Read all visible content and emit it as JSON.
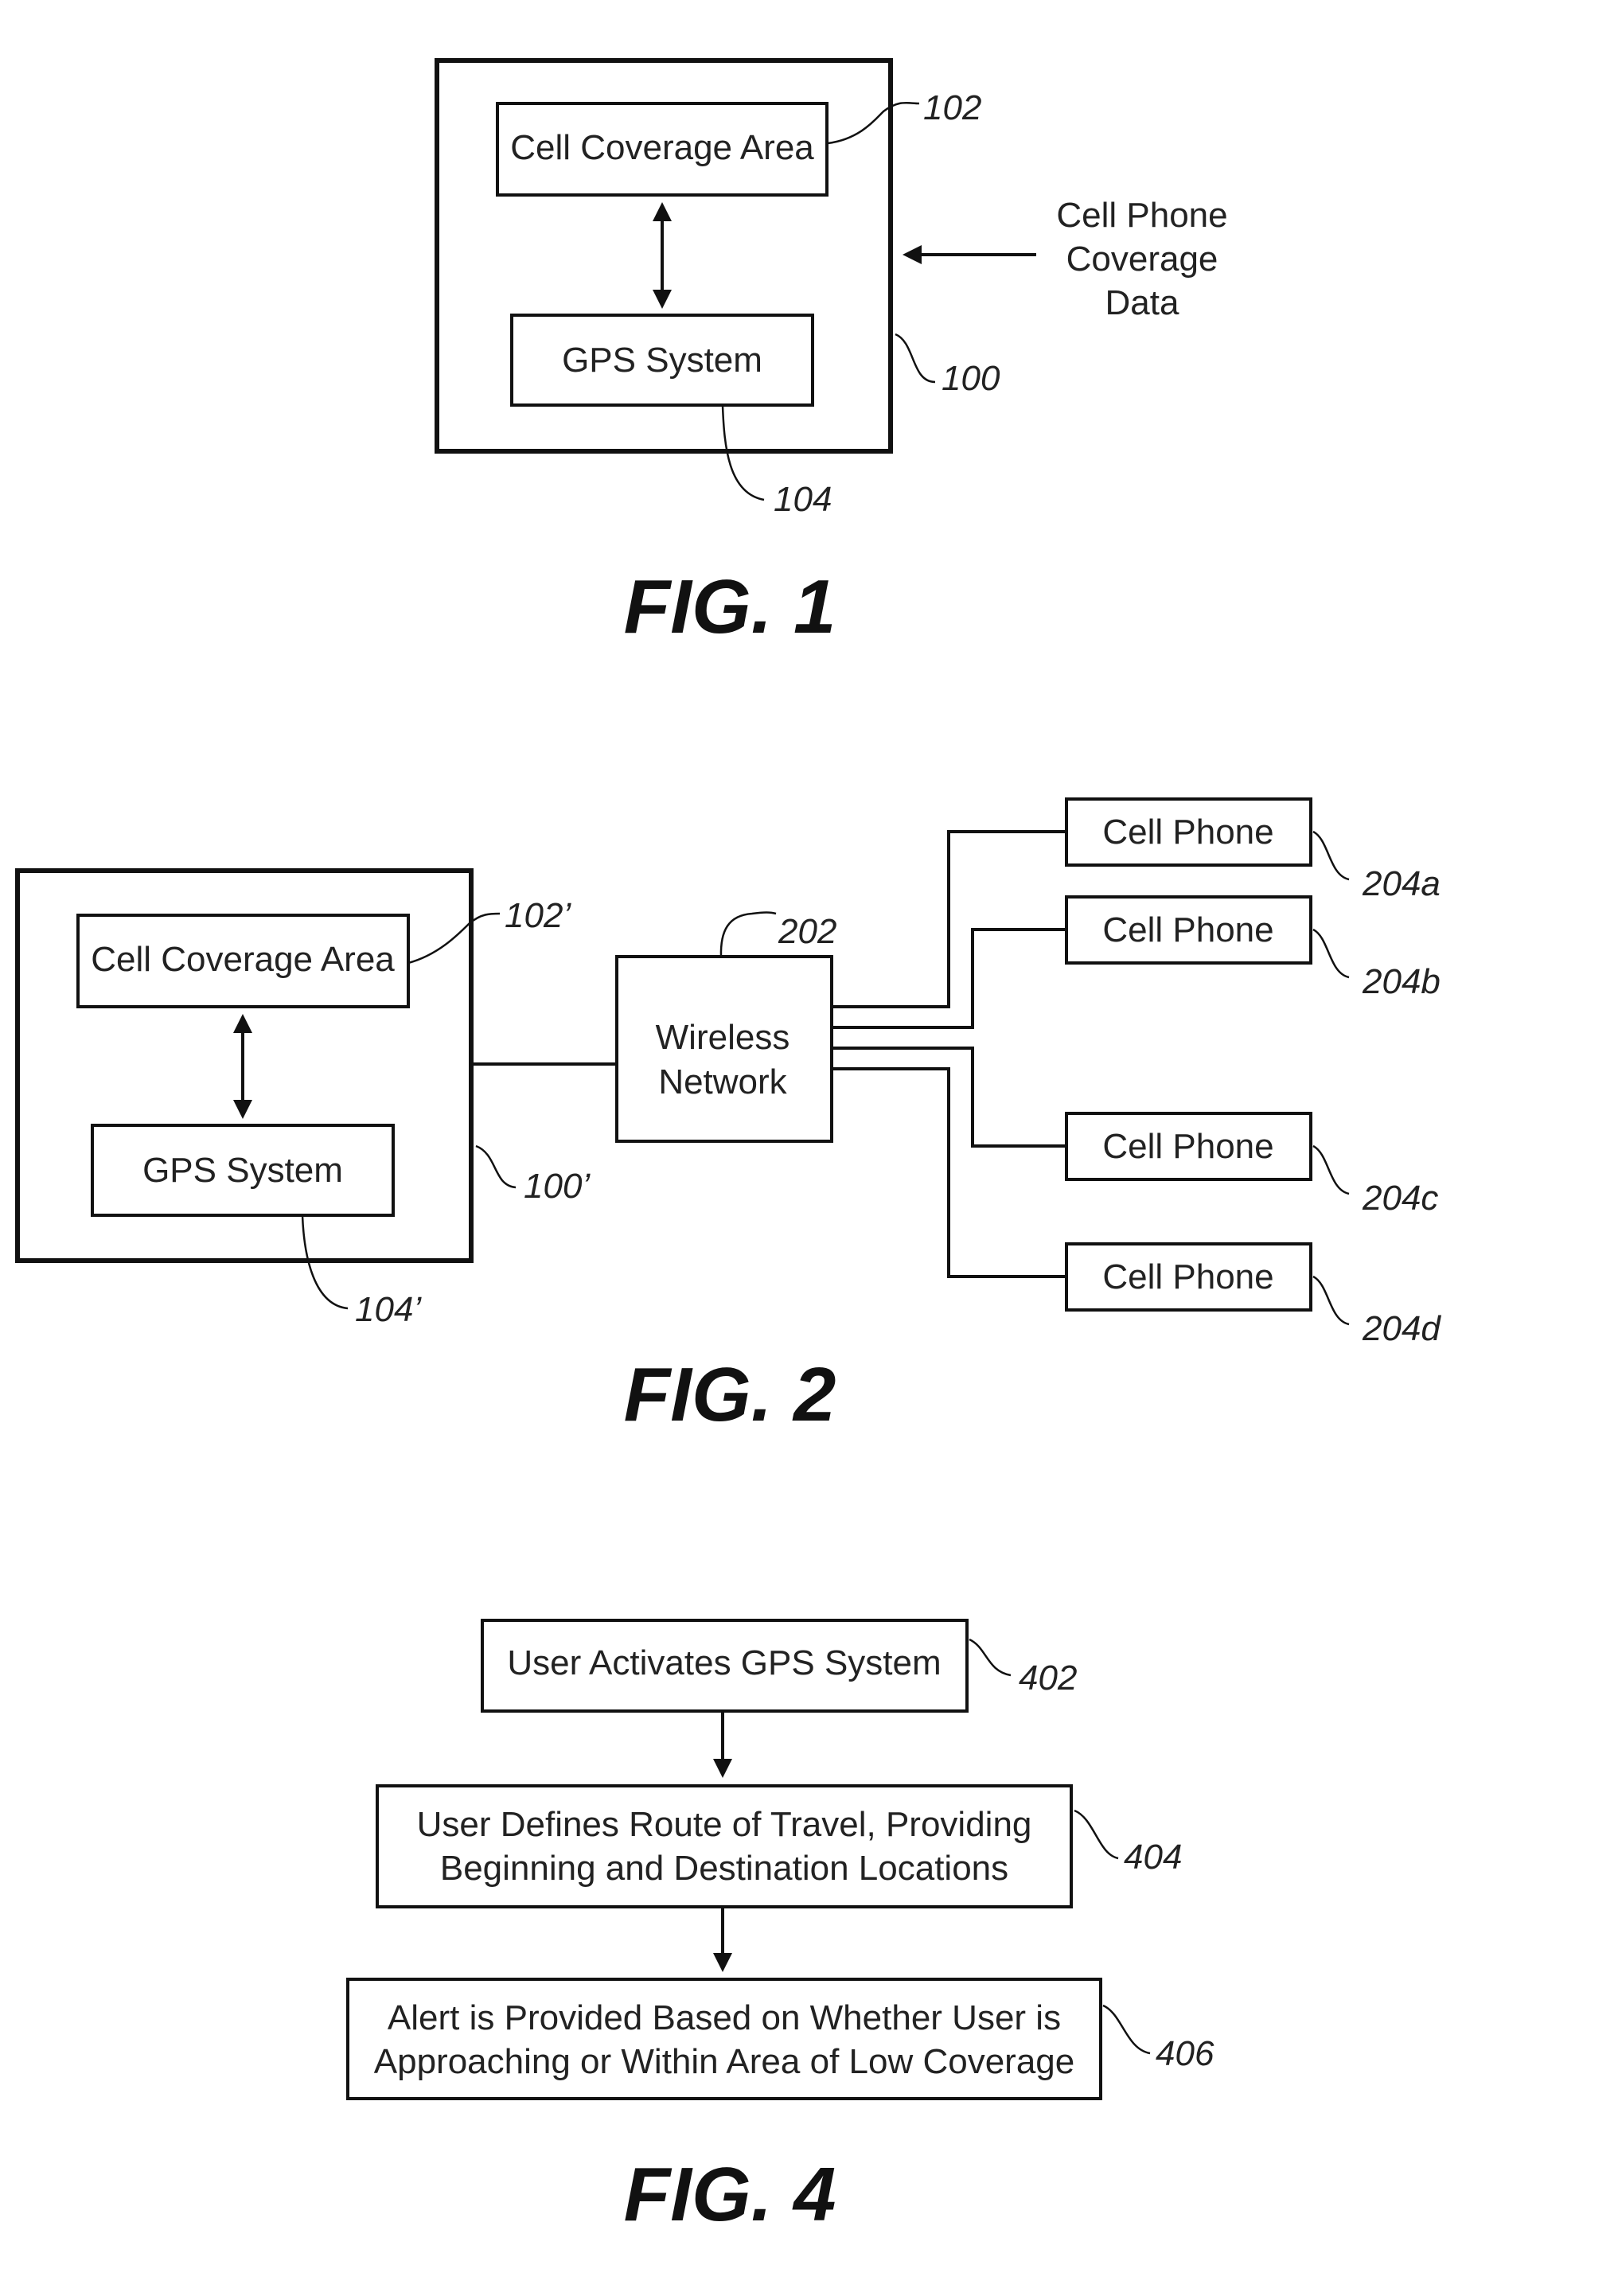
{
  "fig1": {
    "title": "FIG. 1",
    "cell_coverage_area": "Cell Coverage Area",
    "gps_system": "GPS System",
    "input_line1": "Cell Phone",
    "input_line2": "Coverage",
    "input_line3": "Data",
    "ref_outer": "100",
    "ref_cell": "102",
    "ref_gps": "104"
  },
  "fig2": {
    "title": "FIG. 2",
    "cell_coverage_area": "Cell Coverage Area",
    "gps_system": "GPS System",
    "network_line1": "Wireless",
    "network_line2": "Network",
    "ref_outer": "100’",
    "ref_cell": "102’",
    "ref_gps": "104’",
    "ref_network": "202",
    "phones": [
      {
        "label": "Cell Phone",
        "ref": "204a"
      },
      {
        "label": "Cell Phone",
        "ref": "204b"
      },
      {
        "label": "Cell Phone",
        "ref": "204c"
      },
      {
        "label": "Cell Phone",
        "ref": "204d"
      }
    ]
  },
  "fig4": {
    "title": "FIG. 4",
    "steps": [
      {
        "line1": "User Activates GPS System",
        "line2": "",
        "ref": "402"
      },
      {
        "line1": "User Defines Route of Travel, Providing",
        "line2": "Beginning and Destination Locations",
        "ref": "404"
      },
      {
        "line1": "Alert is Provided Based on Whether User is",
        "line2": "Approaching or Within Area of Low Coverage",
        "ref": "406"
      }
    ]
  }
}
